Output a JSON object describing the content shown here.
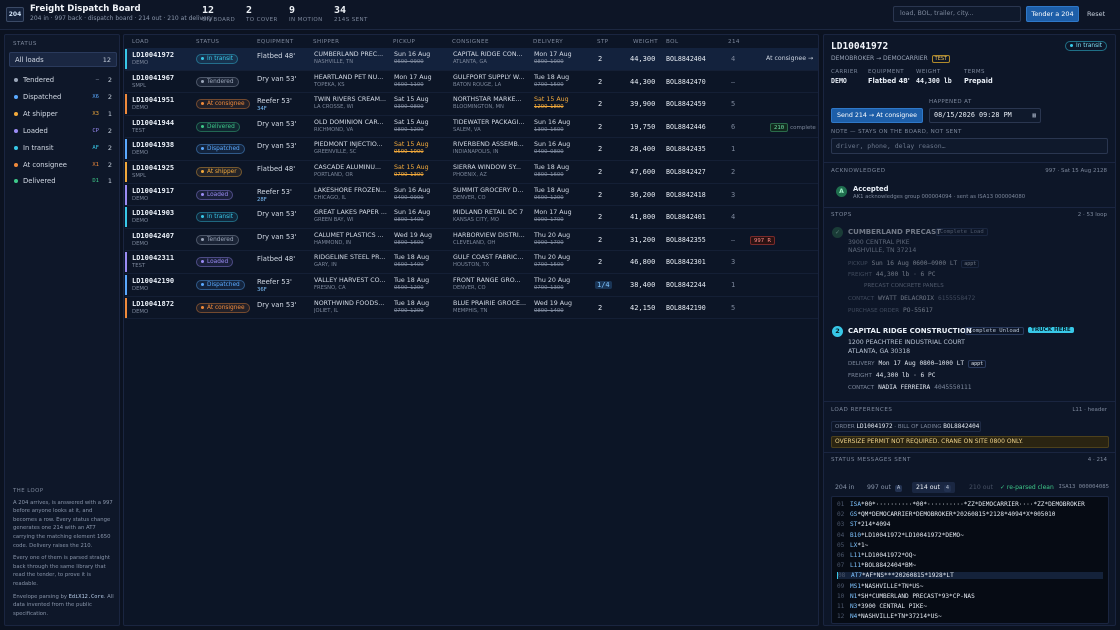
{
  "app": {
    "logo": "204",
    "title": "Freight Dispatch Board",
    "subtitle": "204 in · 997 back · dispatch board · 214 out · 210 at delivery"
  },
  "stats": [
    {
      "value": "12",
      "label": "ON BOARD"
    },
    {
      "value": "2",
      "label": "TO COVER"
    },
    {
      "value": "9",
      "label": "IN MOTION"
    },
    {
      "value": "34",
      "label": "214S SENT"
    }
  ],
  "search": {
    "placeholder": "load, BOL, trailer, city..."
  },
  "actions": {
    "tender": "Tender a 204",
    "reset": "Reset"
  },
  "sidebar": {
    "heading": "STATUS",
    "items": [
      {
        "label": "All loads",
        "code": "",
        "count": "12",
        "color": "#8a96ab"
      },
      {
        "label": "Tendered",
        "code": "—",
        "count": "2",
        "color": "#9aa5b8"
      },
      {
        "label": "Dispatched",
        "code": "X6",
        "count": "2",
        "color": "#5aa9ff"
      },
      {
        "label": "At shipper",
        "code": "X3",
        "count": "1",
        "color": "#f2a93b"
      },
      {
        "label": "Loaded",
        "code": "CP",
        "count": "2",
        "color": "#9b8cf5"
      },
      {
        "label": "In transit",
        "code": "AF",
        "count": "2",
        "color": "#38c8e8"
      },
      {
        "label": "At consignee",
        "code": "X1",
        "count": "2",
        "color": "#f08a3b"
      },
      {
        "label": "Delivered",
        "code": "D1",
        "count": "1",
        "color": "#3ec98a"
      }
    ],
    "loop_heading": "THE LOOP",
    "loop_p1": "A 204 arrives, is answered with a 997 before anyone looks at it, and becomes a row. Every status change generates one 214 with an AT7 carrying the matching element 1650 code. Delivery raises the 210.",
    "loop_p2": "Every one of them is parsed straight back through the same library that read the tender, to prove it is readable.",
    "loop_p3a": "Envelope parsing by ",
    "loop_p3b": "EdiX12.Core",
    "loop_p3c": ". All data invented from the public specification."
  },
  "table": {
    "headers": [
      "LOAD",
      "STATUS",
      "EQUIPMENT",
      "SHIPPER",
      "PICKUP",
      "CONSIGNEE",
      "DELIVERY",
      "STP",
      "WEIGHT",
      "BOL",
      "214"
    ],
    "rows": [
      {
        "id": "LD10041972",
        "sub": "DEMO",
        "status": "In transit",
        "equip": "Flatbed 48'",
        "equip_x": "",
        "shipper": "CUMBERLAND PREC...",
        "shipper_city": "NASHVILLE, TN",
        "pickup": "Sun 16 Aug",
        "pickup_win": "0600–0900",
        "pickup_late": false,
        "consignee": "CAPITAL RIDGE CON...",
        "consignee_city": "ATLANTA, GA",
        "delivery": "Mon 17 Aug",
        "delivery_win": "0800–1000",
        "delivery_late": false,
        "stp": "2",
        "weight": "44,300",
        "bol": "BOL8842404",
        "c214": "4",
        "extra": "At consignee →",
        "extra_type": "text",
        "accent": "#38c8e8",
        "selected": true
      },
      {
        "id": "LD10041967",
        "sub": "SMPL",
        "status": "Tendered",
        "equip": "Dry van 53'",
        "equip_x": "",
        "shipper": "HEARTLAND PET NU...",
        "shipper_city": "TOPEKA, KS",
        "pickup": "Mon 17 Aug",
        "pickup_win": "0600–1100",
        "pickup_late": false,
        "consignee": "GULFPORT SUPPLY W...",
        "consignee_city": "BATON ROUGE, LA",
        "delivery": "Tue 18 Aug",
        "delivery_win": "0700–1500",
        "delivery_late": false,
        "stp": "2",
        "weight": "44,300",
        "bol": "BOL8842470",
        "c214": "—",
        "extra": "",
        "extra_type": "",
        "accent": "",
        "selected": false
      },
      {
        "id": "LD10041951",
        "sub": "DEMO",
        "status": "At consignee",
        "equip": "Reefer 53'",
        "equip_x": "34F",
        "shipper": "TWIN RIVERS CREAM...",
        "shipper_city": "LA CROSSE, WI",
        "pickup": "Sat 15 Aug",
        "pickup_win": "0300–0800",
        "pickup_late": false,
        "consignee": "NORTHSTAR MARKE...",
        "consignee_city": "BLOOMINGTON, MN",
        "delivery": "Sat 15 Aug",
        "delivery_win": "1200–1800",
        "delivery_late": true,
        "stp": "2",
        "weight": "39,900",
        "bol": "BOL8842459",
        "c214": "5",
        "extra": "",
        "extra_type": "",
        "accent": "#f08a3b",
        "selected": false
      },
      {
        "id": "LD10041944",
        "sub": "TEST",
        "status": "Delivered",
        "equip": "Dry van 53'",
        "equip_x": "",
        "shipper": "OLD DOMINION CAR...",
        "shipper_city": "RICHMOND, VA",
        "pickup": "Sat 15 Aug",
        "pickup_win": "0800–1200",
        "pickup_late": false,
        "consignee": "TIDEWATER PACKAGI...",
        "consignee_city": "SALEM, VA",
        "delivery": "Sun 16 Aug",
        "delivery_win": "1300–1600",
        "delivery_late": false,
        "stp": "2",
        "weight": "19,750",
        "bol": "BOL8842446",
        "c214": "6",
        "extra": "210",
        "extra2": "complete",
        "extra_type": "chip-green",
        "accent": "",
        "selected": false
      },
      {
        "id": "LD10041938",
        "sub": "DEMO",
        "status": "Dispatched",
        "equip": "Dry van 53'",
        "equip_x": "",
        "shipper": "PIEDMONT INJECTIO...",
        "shipper_city": "GREENVILLE, SC",
        "pickup": "Sat 15 Aug",
        "pickup_win": "0500–1000",
        "pickup_late": true,
        "consignee": "RIVERBEND ASSEMB...",
        "consignee_city": "INDIANAPOLIS, IN",
        "delivery": "Sun 16 Aug",
        "delivery_win": "0400–0800",
        "delivery_late": false,
        "stp": "2",
        "weight": "28,400",
        "bol": "BOL8842435",
        "c214": "1",
        "extra": "",
        "extra_type": "",
        "accent": "#5aa9ff",
        "selected": false
      },
      {
        "id": "LD10041925",
        "sub": "SMPL",
        "status": "At shipper",
        "equip": "Flatbed 48'",
        "equip_x": "",
        "shipper": "CASCADE ALUMINU...",
        "shipper_city": "PORTLAND, OR",
        "pickup": "Sat 15 Aug",
        "pickup_win": "0700–1300",
        "pickup_late": true,
        "consignee": "SIERRA WINDOW SY...",
        "consignee_city": "PHOENIX, AZ",
        "delivery": "Tue 18 Aug",
        "delivery_win": "0800–1600",
        "delivery_late": false,
        "stp": "2",
        "weight": "47,600",
        "bol": "BOL8842427",
        "c214": "2",
        "extra": "",
        "extra_type": "",
        "accent": "#f2a93b",
        "selected": false
      },
      {
        "id": "LD10041917",
        "sub": "DEMO",
        "status": "Loaded",
        "equip": "Reefer 53'",
        "equip_x": "28F",
        "shipper": "LAKESHORE FROZEN...",
        "shipper_city": "CHICAGO, IL",
        "pickup": "Sun 16 Aug",
        "pickup_win": "0400–0900",
        "pickup_late": false,
        "consignee": "SUMMIT GROCERY D...",
        "consignee_city": "DENVER, CO",
        "delivery": "Tue 18 Aug",
        "delivery_win": "0600–1200",
        "delivery_late": false,
        "stp": "2",
        "weight": "36,200",
        "bol": "BOL8842418",
        "c214": "3",
        "extra": "",
        "extra_type": "",
        "accent": "#9b8cf5",
        "selected": false
      },
      {
        "id": "LD10041903",
        "sub": "DEMO",
        "status": "In transit",
        "equip": "Dry van 53'",
        "equip_x": "",
        "shipper": "GREAT LAKES PAPER ...",
        "shipper_city": "GREEN BAY, WI",
        "pickup": "Sun 16 Aug",
        "pickup_win": "0800–1400",
        "pickup_late": false,
        "consignee": "MIDLAND RETAIL DC 7",
        "consignee_city": "KANSAS CITY, MO",
        "delivery": "Mon 17 Aug",
        "delivery_win": "0900–1700",
        "delivery_late": false,
        "stp": "2",
        "weight": "41,800",
        "bol": "BOL8842401",
        "c214": "4",
        "extra": "",
        "extra_type": "",
        "accent": "#38c8e8",
        "selected": false
      },
      {
        "id": "LD10042407",
        "sub": "DEMO",
        "status": "Tendered",
        "equip": "Dry van 53'",
        "equip_x": "",
        "shipper": "CALUMET PLASTICS ...",
        "shipper_city": "HAMMOND, IN",
        "pickup": "Wed 19 Aug",
        "pickup_win": "0800–1600",
        "pickup_late": false,
        "consignee": "HARBORVIEW DISTRI...",
        "consignee_city": "CLEVELAND, OH",
        "delivery": "Thu 20 Aug",
        "delivery_win": "0900–1700",
        "delivery_late": false,
        "stp": "2",
        "weight": "31,200",
        "bol": "BOL8842355",
        "c214": "—",
        "extra": "997 R",
        "extra_type": "chip-red",
        "accent": "",
        "selected": false
      },
      {
        "id": "LD10042311",
        "sub": "TEST",
        "status": "Loaded",
        "equip": "Flatbed 48'",
        "equip_x": "",
        "shipper": "RIDGELINE STEEL PR...",
        "shipper_city": "GARY, IN",
        "pickup": "Tue 18 Aug",
        "pickup_win": "0600–1400",
        "pickup_late": false,
        "consignee": "GULF COAST FABRIC...",
        "consignee_city": "HOUSTON, TX",
        "delivery": "Thu 20 Aug",
        "delivery_win": "0700–1500",
        "delivery_late": false,
        "stp": "2",
        "weight": "46,800",
        "bol": "BOL8842301",
        "c214": "3",
        "extra": "",
        "extra_type": "",
        "accent": "#9b8cf5",
        "selected": false
      },
      {
        "id": "LD10042190",
        "sub": "DEMO",
        "status": "Dispatched",
        "equip": "Reefer 53'",
        "equip_x": "36F",
        "shipper": "VALLEY HARVEST CO...",
        "shipper_city": "FRESNO, CA",
        "pickup": "Tue 18 Aug",
        "pickup_win": "0500–1200",
        "pickup_late": false,
        "consignee": "FRONT RANGE GRO...",
        "consignee_city": "DENVER, CO",
        "delivery": "Thu 20 Aug",
        "delivery_win": "0700–1300",
        "delivery_late": false,
        "stp": "1/4",
        "weight": "38,400",
        "bol": "BOL8842244",
        "c214": "1",
        "extra": "",
        "extra_type": "",
        "accent": "#5aa9ff",
        "selected": false
      },
      {
        "id": "LD10041872",
        "sub": "DEMO",
        "status": "At consignee",
        "equip": "Dry van 53'",
        "equip_x": "",
        "shipper": "NORTHWIND FOODS...",
        "shipper_city": "JOLIET, IL",
        "pickup": "Tue 18 Aug",
        "pickup_win": "0700–1200",
        "pickup_late": false,
        "consignee": "BLUE PRAIRIE GROCE...",
        "consignee_city": "MEMPHIS, TN",
        "delivery": "Wed 19 Aug",
        "delivery_win": "0800–1400",
        "delivery_late": false,
        "stp": "2",
        "weight": "42,150",
        "bol": "BOL8842190",
        "c214": "5",
        "extra": "",
        "extra_type": "",
        "accent": "#f08a3b",
        "selected": false
      }
    ]
  },
  "status_colors": {
    "Tendered": "#9aa5b8",
    "Dispatched": "#5aa9ff",
    "At shipper": "#f2a93b",
    "Loaded": "#9b8cf5",
    "In transit": "#38c8e8",
    "At consignee": "#f08a3b",
    "Delivered": "#3ec98a"
  },
  "detail": {
    "load_id": "LD10041972",
    "status": "In transit",
    "route": "DEMOBROKER → DEMOCARRIER",
    "env": "TEST",
    "carrier_label": "CARRIER",
    "carrier": "DEMO",
    "equipment_label": "EQUIPMENT",
    "equipment": "Flatbed 48'",
    "weight_label": "WEIGHT",
    "weight": "44,300 lb",
    "terms_label": "TERMS",
    "terms": "Prepaid",
    "send_button": "Send 214 → At consignee",
    "happened_label": "HAPPENED AT",
    "happened_at": "08/15/2026 09:28 PM",
    "note_label": "NOTE — STAYS ON THE BOARD, NOT SENT",
    "note_placeholder": "driver, phone, delay reason…",
    "ack_heading": "ACKNOWLEDGED",
    "ack_meta": "997 · Sat 15 Aug 2128",
    "ack_title": "Accepted",
    "ack_sub": "AK1 acknowledges group 000004094 · sent as ISA13 000004080",
    "stops_heading": "STOPS",
    "stops_meta": "2 · 53 loop",
    "stop1": {
      "num": "1",
      "name": "CUMBERLAND PRECAST",
      "tag": "Complete Load",
      "addr1": "3900 CENTRAL PIKE",
      "addr2": "NASHVILLE, TN 37214",
      "k1": "PICKUP",
      "v1": "Sun 16 Aug 0600–0900 LT",
      "appt": "appt",
      "k2": "FREIGHT",
      "v2": "44,300 lb · 6 PC",
      "desc": "PRECAST CONCRETE PANELS",
      "k3": "CONTACT",
      "v3": "WYATT DELACROIX",
      "v3b": "6155558472",
      "k4": "PURCHASE ORDER",
      "v4": "PO-55617"
    },
    "stop2": {
      "num": "2",
      "name": "CAPITAL RIDGE CONSTRUCTION",
      "tag": "Complete Unload",
      "here": "TRUCK HERE",
      "addr1": "1200 PEACHTREE INDUSTRIAL COURT",
      "addr2": "ATLANTA, GA 30318",
      "k1": "DELIVERY",
      "v1": "Mon 17 Aug 0800–1000 LT",
      "appt": "appt",
      "k2": "FREIGHT",
      "v2": "44,300 lb · 6 PC",
      "k3": "CONTACT",
      "v3": "NADIA FERREIRA",
      "v3b": "4045550111"
    },
    "refs_heading": "LOAD REFERENCES",
    "refs_meta": "L11 · header",
    "order_label": "ORDER",
    "order": "LD10041972",
    "bol_label": "BILL OF LADING",
    "bol": "BOL8842404",
    "notice": "OVERSIZE PERMIT NOT REQUIRED. CRANE ON SITE 0800 ONLY.",
    "msgs_heading": "STATUS MESSAGES SENT",
    "msgs_meta": "4 · 214",
    "tabs": [
      {
        "label": "204 in",
        "count": ""
      },
      {
        "label": "997 out",
        "count": "A"
      },
      {
        "label": "214 out",
        "count": "4"
      },
      {
        "label": "210 out",
        "count": ""
      }
    ],
    "parsed": "✓ re-parsed clean",
    "isa": "ISA13 000004085",
    "edi_lines": [
      {
        "n": "01",
        "seg": "ISA",
        "rest": "*00*··········*00*··········*ZZ*DEMOCARRIER····*ZZ*DEMOBROKER"
      },
      {
        "n": "02",
        "seg": "GS",
        "rest": "*QM*DEMOCARRIER*DEMOBROKER*20260815*2128*4094*X*005010"
      },
      {
        "n": "03",
        "seg": "ST",
        "rest": "*214*4094"
      },
      {
        "n": "04",
        "seg": "B10",
        "rest": "*LD10041972*LD10041972*DEMO~"
      },
      {
        "n": "05",
        "seg": "LX",
        "rest": "*1~"
      },
      {
        "n": "06",
        "seg": "L11",
        "rest": "*LD10041972*OQ~"
      },
      {
        "n": "07",
        "seg": "L11",
        "rest": "*BOL8842404*BM~"
      },
      {
        "n": "08",
        "seg": "AT7",
        "rest": "*AF*NS***20260815*1928*LT"
      },
      {
        "n": "09",
        "seg": "MS1",
        "rest": "*NASHVILLE*TN*US~"
      },
      {
        "n": "10",
        "seg": "N1",
        "rest": "*SH*CUMBERLAND PRECAST*93*CP-NAS"
      },
      {
        "n": "11",
        "seg": "N3",
        "rest": "*3900 CENTRAL PIKE~"
      },
      {
        "n": "12",
        "seg": "N4",
        "rest": "*NASHVILLE*TN*37214*US~"
      }
    ]
  }
}
